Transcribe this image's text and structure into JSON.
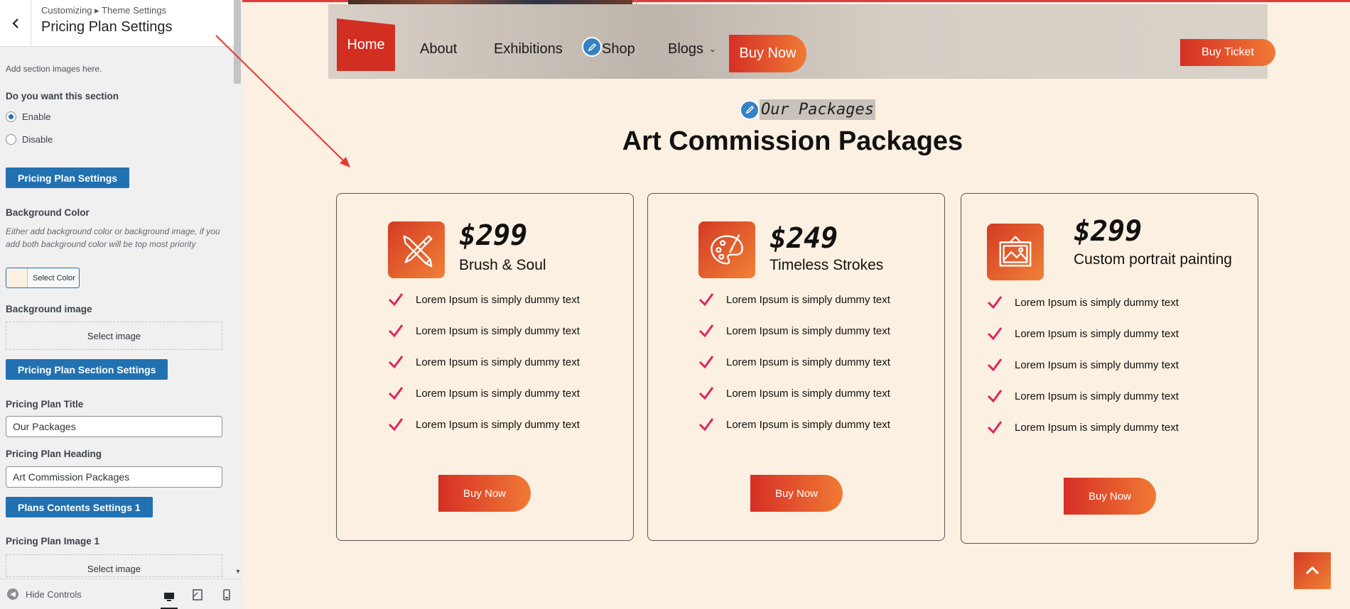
{
  "sidebar": {
    "breadcrumb": "Customizing ▸ Theme Settings",
    "title": "Pricing Plan Settings",
    "add_images_note": "Add section images here.",
    "section_toggle_label": "Do you want this section",
    "radio_options": [
      {
        "label": "Enable",
        "checked": true
      },
      {
        "label": "Disable",
        "checked": false
      }
    ],
    "pricing_plan_settings_btn": "Pricing Plan Settings",
    "bg_color_label": "Background Color",
    "bg_color_note": "Either add background color or background image, if you add both background color will be top most priority",
    "select_color_label": "Select Color",
    "bg_color_value": "#fbf0e1",
    "bg_image_label": "Background image",
    "select_image_label": "Select image",
    "section_settings_btn": "Pricing Plan Section Settings",
    "plan_title_label": "Pricing Plan Title",
    "plan_title_value": "Our Packages",
    "plan_heading_label": "Pricing Plan Heading",
    "plan_heading_value": "Art Commission Packages",
    "contents_settings_btn": "Plans Contents Settings 1",
    "plan_image_label": "Pricing Plan Image 1",
    "select_image_label_2": "Select image",
    "hide_controls": "Hide Controls"
  },
  "nav": {
    "home": "Home",
    "about": "About",
    "exhibitions": "Exhibitions",
    "shop": "Shop",
    "blogs": "Blogs",
    "blogs_chevron": "⌄",
    "buy_now": "Buy Now",
    "buy_ticket": "Buy Ticket"
  },
  "section": {
    "title": "Our Packages",
    "heading": "Art Commission Packages"
  },
  "cards": [
    {
      "price": "$299",
      "name": "Brush & Soul",
      "icon": "brush-pencil-icon",
      "features": [
        "Lorem Ipsum is simply dummy text",
        "Lorem Ipsum is simply dummy text",
        "Lorem Ipsum is simply dummy text",
        "Lorem Ipsum is simply dummy text",
        "Lorem Ipsum is simply dummy text"
      ],
      "button": "Buy Now"
    },
    {
      "price": "$249",
      "name": "Timeless Strokes",
      "icon": "palette-icon",
      "features": [
        "Lorem Ipsum is simply dummy text",
        "Lorem Ipsum is simply dummy text",
        "Lorem Ipsum is simply dummy text",
        "Lorem Ipsum is simply dummy text",
        "Lorem Ipsum is simply dummy text"
      ],
      "button": "Buy Now"
    },
    {
      "price": "$299",
      "name": "Custom portrait painting",
      "icon": "framed-picture-icon",
      "features": [
        "Lorem Ipsum is simply dummy text",
        "Lorem Ipsum is simply dummy text",
        "Lorem Ipsum is simply dummy text",
        "Lorem Ipsum is simply dummy text",
        "Lorem Ipsum is simply dummy text"
      ],
      "button": "Buy Now"
    }
  ],
  "colors": {
    "accent_start": "#d62f25",
    "accent_end": "#f07a35",
    "wp_blue": "#2271b1",
    "check_color": "#e0245e",
    "annotation_arrow": "#e53935"
  }
}
